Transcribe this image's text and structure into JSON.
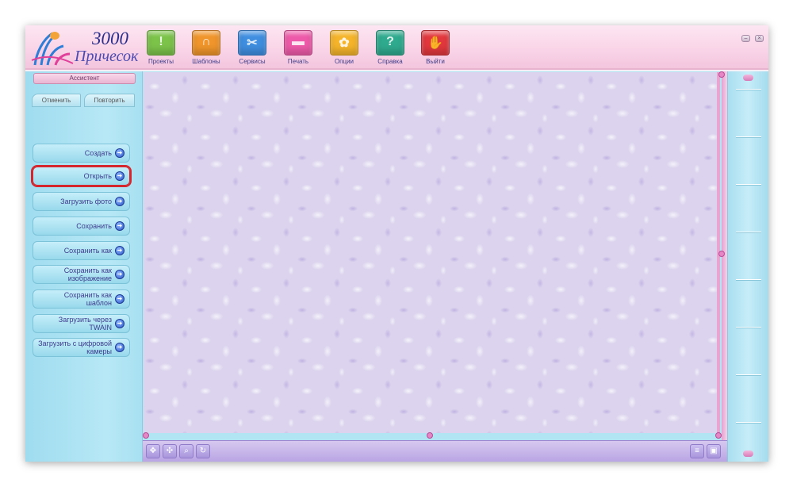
{
  "app": {
    "logo_number": "3000",
    "logo_word": "Причесок",
    "brand_color": "#2a2d8a"
  },
  "toolbar": {
    "items": [
      {
        "label": "Проекты",
        "icon": "projects-icon",
        "color": "#7cc34a"
      },
      {
        "label": "Шаблоны",
        "icon": "templates-icon",
        "color": "#f0952b"
      },
      {
        "label": "Сервисы",
        "icon": "services-icon",
        "color": "#3f8ee0"
      },
      {
        "label": "Печать",
        "icon": "print-icon",
        "color": "#ee5aa9"
      },
      {
        "label": "Опции",
        "icon": "options-icon",
        "color": "#f5b42a"
      },
      {
        "label": "Справка",
        "icon": "help-icon",
        "color": "#2faa8e"
      },
      {
        "label": "Выйти",
        "icon": "exit-icon",
        "color": "#e2383d"
      }
    ]
  },
  "window_controls": {
    "minimize_icon": "minimize-icon",
    "close_icon": "close-icon"
  },
  "sidebar": {
    "assistant_label": "Ассистент",
    "undo_label": "Отменить",
    "redo_label": "Повторить",
    "buttons": [
      {
        "label": "Создать",
        "highlighted": false
      },
      {
        "label": "Открыть",
        "highlighted": true
      },
      {
        "label": "Загрузить фото",
        "highlighted": false
      },
      {
        "label": "Сохранить",
        "highlighted": false
      },
      {
        "label": "Сохранить как",
        "highlighted": false
      },
      {
        "label": "Сохранить как изображение",
        "highlighted": false
      },
      {
        "label": "Сохранить как шаблон",
        "highlighted": false
      },
      {
        "label": "Загрузить через TWAIN",
        "highlighted": false
      },
      {
        "label": "Загрузить с цифровой камеры",
        "highlighted": false
      }
    ],
    "highlight_color": "#d5252d"
  },
  "bottom_toolbar": {
    "left_icons": [
      "move-icon",
      "pan-icon",
      "zoom-icon",
      "rotate-icon"
    ],
    "right_icons": [
      "list-icon",
      "layout-icon"
    ]
  },
  "ruler": {
    "up_icon": "scroll-up-icon",
    "down_icon": "scroll-down-icon"
  }
}
